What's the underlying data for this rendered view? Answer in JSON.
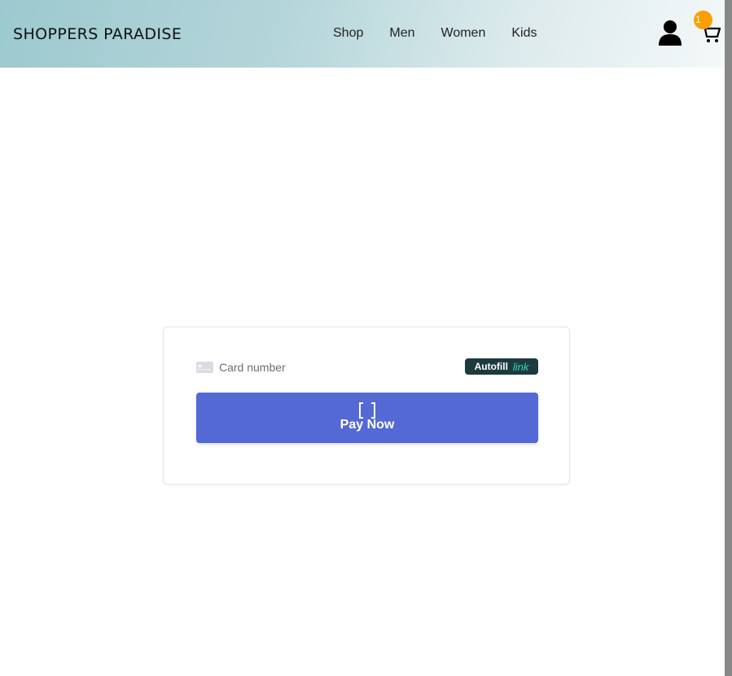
{
  "header": {
    "brand": "SHOPPERS PARADISE",
    "nav": [
      "Shop",
      "Men",
      "Women",
      "Kids"
    ],
    "user_icon": "user-icon",
    "cart_icon": "cart-icon",
    "cart_count": "1",
    "badge_color": "#ff9e00"
  },
  "payment": {
    "card_icon": "credit-card-icon",
    "card_placeholder": "Card number",
    "autofill_label": "Autofill",
    "autofill_link": "link",
    "autofill_bg": "#1d3a3f",
    "link_color": "#33ddb3",
    "spinner_icon": "loading-spinner-icon",
    "pay_label": "Pay Now",
    "pay_color": "#5469d4"
  }
}
